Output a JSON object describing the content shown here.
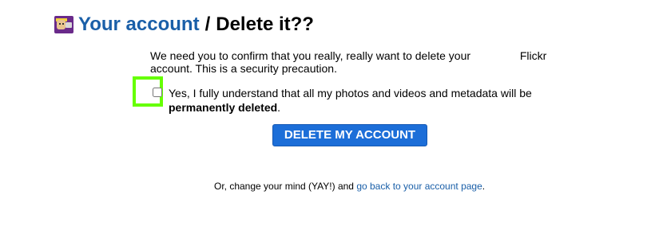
{
  "header": {
    "link_text": "Your account",
    "separator": "/",
    "rest": "Delete it??",
    "icon": "buddy-icon"
  },
  "confirm": {
    "line1_prefix": "We need you to confirm that you really, really want to delete your",
    "brand": "Flickr",
    "line2": "account. This is a security precaution."
  },
  "acknowledge": {
    "checked": false,
    "text_prefix": "Yes, I fully understand that all my photos and videos and metadata will be",
    "text_bold": "permanently deleted",
    "text_suffix": "."
  },
  "delete_button": {
    "label": "DELETE MY ACCOUNT"
  },
  "footer": {
    "prefix": "Or, change your mind (YAY!) and",
    "link_text": "go back to your account page",
    "suffix": "."
  },
  "colors": {
    "link": "#1a5fa8",
    "button": "#1c6ed8",
    "highlight": "#66ff00"
  }
}
